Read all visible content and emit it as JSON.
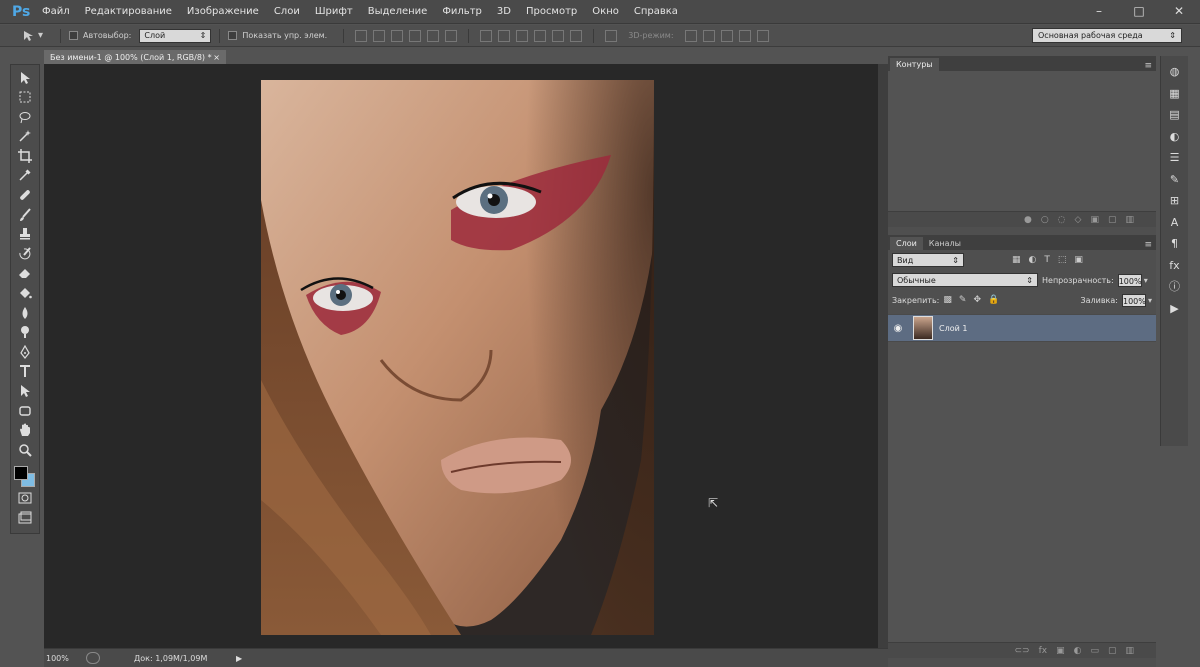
{
  "app": {
    "logo": "Ps"
  },
  "menu": [
    "Файл",
    "Редактирование",
    "Изображение",
    "Слои",
    "Шрифт",
    "Выделение",
    "Фильтр",
    "3D",
    "Просмотр",
    "Окно",
    "Справка"
  ],
  "window_controls": [
    "–",
    "□",
    "✕"
  ],
  "options": {
    "autoselect_label": "Автовыбор:",
    "autoselect_value": "Слой",
    "show_transform": "Показать упр. элем.",
    "mode_3d": "3D-режим:",
    "workspace": "Основная рабочая среда"
  },
  "document": {
    "tab_title": "Без имени-1 @ 100% (Слой 1, RGB/8) *",
    "zoom": "100%",
    "doc_info": "Док: 1,09M/1,09M"
  },
  "panels": {
    "paths_tab": "Контуры",
    "layers_tab": "Слои",
    "channels_tab": "Каналы",
    "filter_kind": "Вид",
    "blend_mode": "Обычные",
    "opacity_label": "Непрозрачность:",
    "opacity_value": "100%",
    "lock_label": "Закрепить:",
    "fill_label": "Заливка:",
    "fill_value": "100%",
    "layer_name": "Слой 1"
  },
  "tools": [
    "move-tool-icon",
    "marquee-tool-icon",
    "lasso-tool-icon",
    "magic-wand-icon",
    "crop-tool-icon",
    "eyedropper-icon",
    "healing-brush-icon",
    "brush-tool-icon",
    "stamp-tool-icon",
    "history-brush-icon",
    "eraser-tool-icon",
    "paint-bucket-icon",
    "blur-tool-icon",
    "dodge-tool-icon",
    "pen-tool-icon",
    "type-tool-icon",
    "path-selection-icon",
    "shape-tool-icon",
    "hand-tool-icon",
    "zoom-tool-icon"
  ],
  "colors": {
    "foreground": "#000000",
    "background": "#7fbde4",
    "layer_highlight": "#5d6c82"
  }
}
